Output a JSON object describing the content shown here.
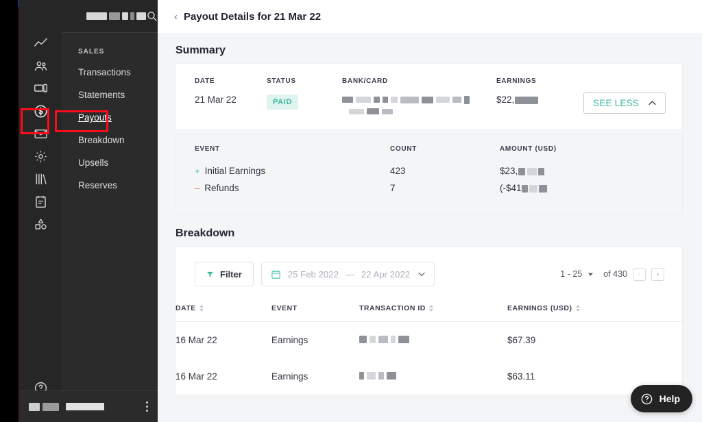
{
  "sidebar": {
    "logo_redacted": true,
    "search_icon": "search-icon",
    "rail_icons": [
      "chart-line-icon",
      "people-icon",
      "devices-icon",
      "dollar-circle-icon",
      "envelope-icon",
      "gear-icon",
      "books-icon",
      "clipboard-icon",
      "shapes-icon"
    ],
    "rail_bottom_icons": [
      "help-circle-icon",
      "group-icon"
    ],
    "section_label": "SALES",
    "items": [
      {
        "label": "Transactions",
        "active": false
      },
      {
        "label": "Statements",
        "active": false
      },
      {
        "label": "Payouts",
        "active": true
      },
      {
        "label": "Breakdown",
        "active": false
      },
      {
        "label": "Upsells",
        "active": false
      },
      {
        "label": "Reserves",
        "active": false
      }
    ],
    "user_redacted": true,
    "more_icon": "vertical-dots-icon"
  },
  "header": {
    "back_icon": "chevron-left-icon",
    "title": "Payout Details for 21 Mar 22"
  },
  "summary": {
    "title": "Summary",
    "columns": {
      "date": "DATE",
      "status": "STATUS",
      "bank_card": "BANK/CARD",
      "earnings": "EARNINGS"
    },
    "date_value": "21 Mar 22",
    "status_value": "PAID",
    "bank_card_value": "",
    "earnings_value": "$22,",
    "see_less_label": "SEE LESS",
    "see_less_icon": "chevron-up-icon",
    "event_columns": {
      "event": "EVENT",
      "count": "COUNT",
      "amount": "AMOUNT (USD)"
    },
    "events": [
      {
        "sign": "+",
        "label": "Initial Earnings",
        "count": "423",
        "amount": "$23,"
      },
      {
        "sign": "–",
        "label": "Refunds",
        "count": "7",
        "amount": "(-$41"
      }
    ]
  },
  "breakdown": {
    "title": "Breakdown",
    "filter_label": "Filter",
    "filter_icon": "funnel-icon",
    "calendar_icon": "calendar-icon",
    "date_from": "25 Feb 2022",
    "date_dash": "—",
    "date_to": "22 Apr 2022",
    "date_chevron_icon": "chevron-down-icon",
    "page_range": "1 - 25",
    "page_range_chevron_icon": "chevron-down-icon",
    "page_total": "of 430",
    "prev_label": "‹",
    "next_label": "›",
    "table_headers": {
      "date": "DATE",
      "event": "EVENT",
      "transaction_id": "TRANSACTION ID",
      "earnings": "EARNINGS (USD)"
    },
    "rows": [
      {
        "date": "16 Mar 22",
        "event": "Earnings",
        "transaction_id": "",
        "earnings": "$67.39"
      },
      {
        "date": "16 Mar 22",
        "event": "Earnings",
        "transaction_id": "",
        "earnings": "$63.11"
      }
    ]
  },
  "help_widget": {
    "label": "Help",
    "icon": "question-circle-icon"
  },
  "colors": {
    "accent_teal": "#3fb8a0",
    "badge_bg": "#dff3ef",
    "annotation_red": "#fc0d1b",
    "sidebar_dark": "#2b2b2b",
    "rail_dark": "#262626",
    "page_bg": "#f4f5f7",
    "minus_red": "#ef6b5a"
  }
}
